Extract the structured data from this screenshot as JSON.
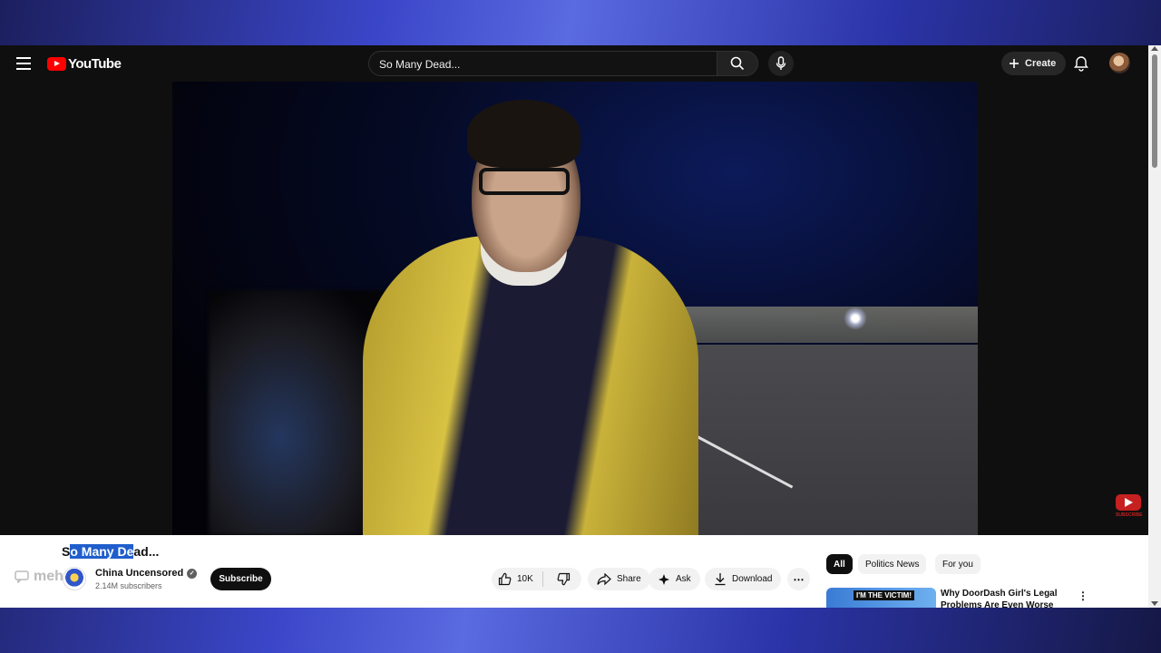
{
  "app": {
    "name": "YouTube"
  },
  "search": {
    "value": "So Many Dead..."
  },
  "header": {
    "create_label": "Create"
  },
  "video": {
    "title_highlighted": "o Many De",
    "title_prefix": "S",
    "title_suffix": "ad...",
    "watermark_label": "SUBSCRIBE"
  },
  "channel": {
    "name": "China Uncensored",
    "subscribers": "2.14M subscribers",
    "subscribe_label": "Subscribe",
    "overlay_watermark": "meh"
  },
  "actions": {
    "like_count": "10K",
    "share_label": "Share",
    "ask_label": "Ask",
    "download_label": "Download"
  },
  "chips": [
    {
      "label": "All",
      "active": true
    },
    {
      "label": "Politics News",
      "active": false
    },
    {
      "label": "For you",
      "active": false
    }
  ],
  "recommendations": [
    {
      "title": "Why DoorDash Girl's Legal Problems Are Even Worse |",
      "thumb_label": "I'M THE VICTIM!"
    }
  ],
  "colors": {
    "brand": "#ff0000",
    "highlight": "#1f5ecc",
    "background": "#0f0f0f"
  }
}
